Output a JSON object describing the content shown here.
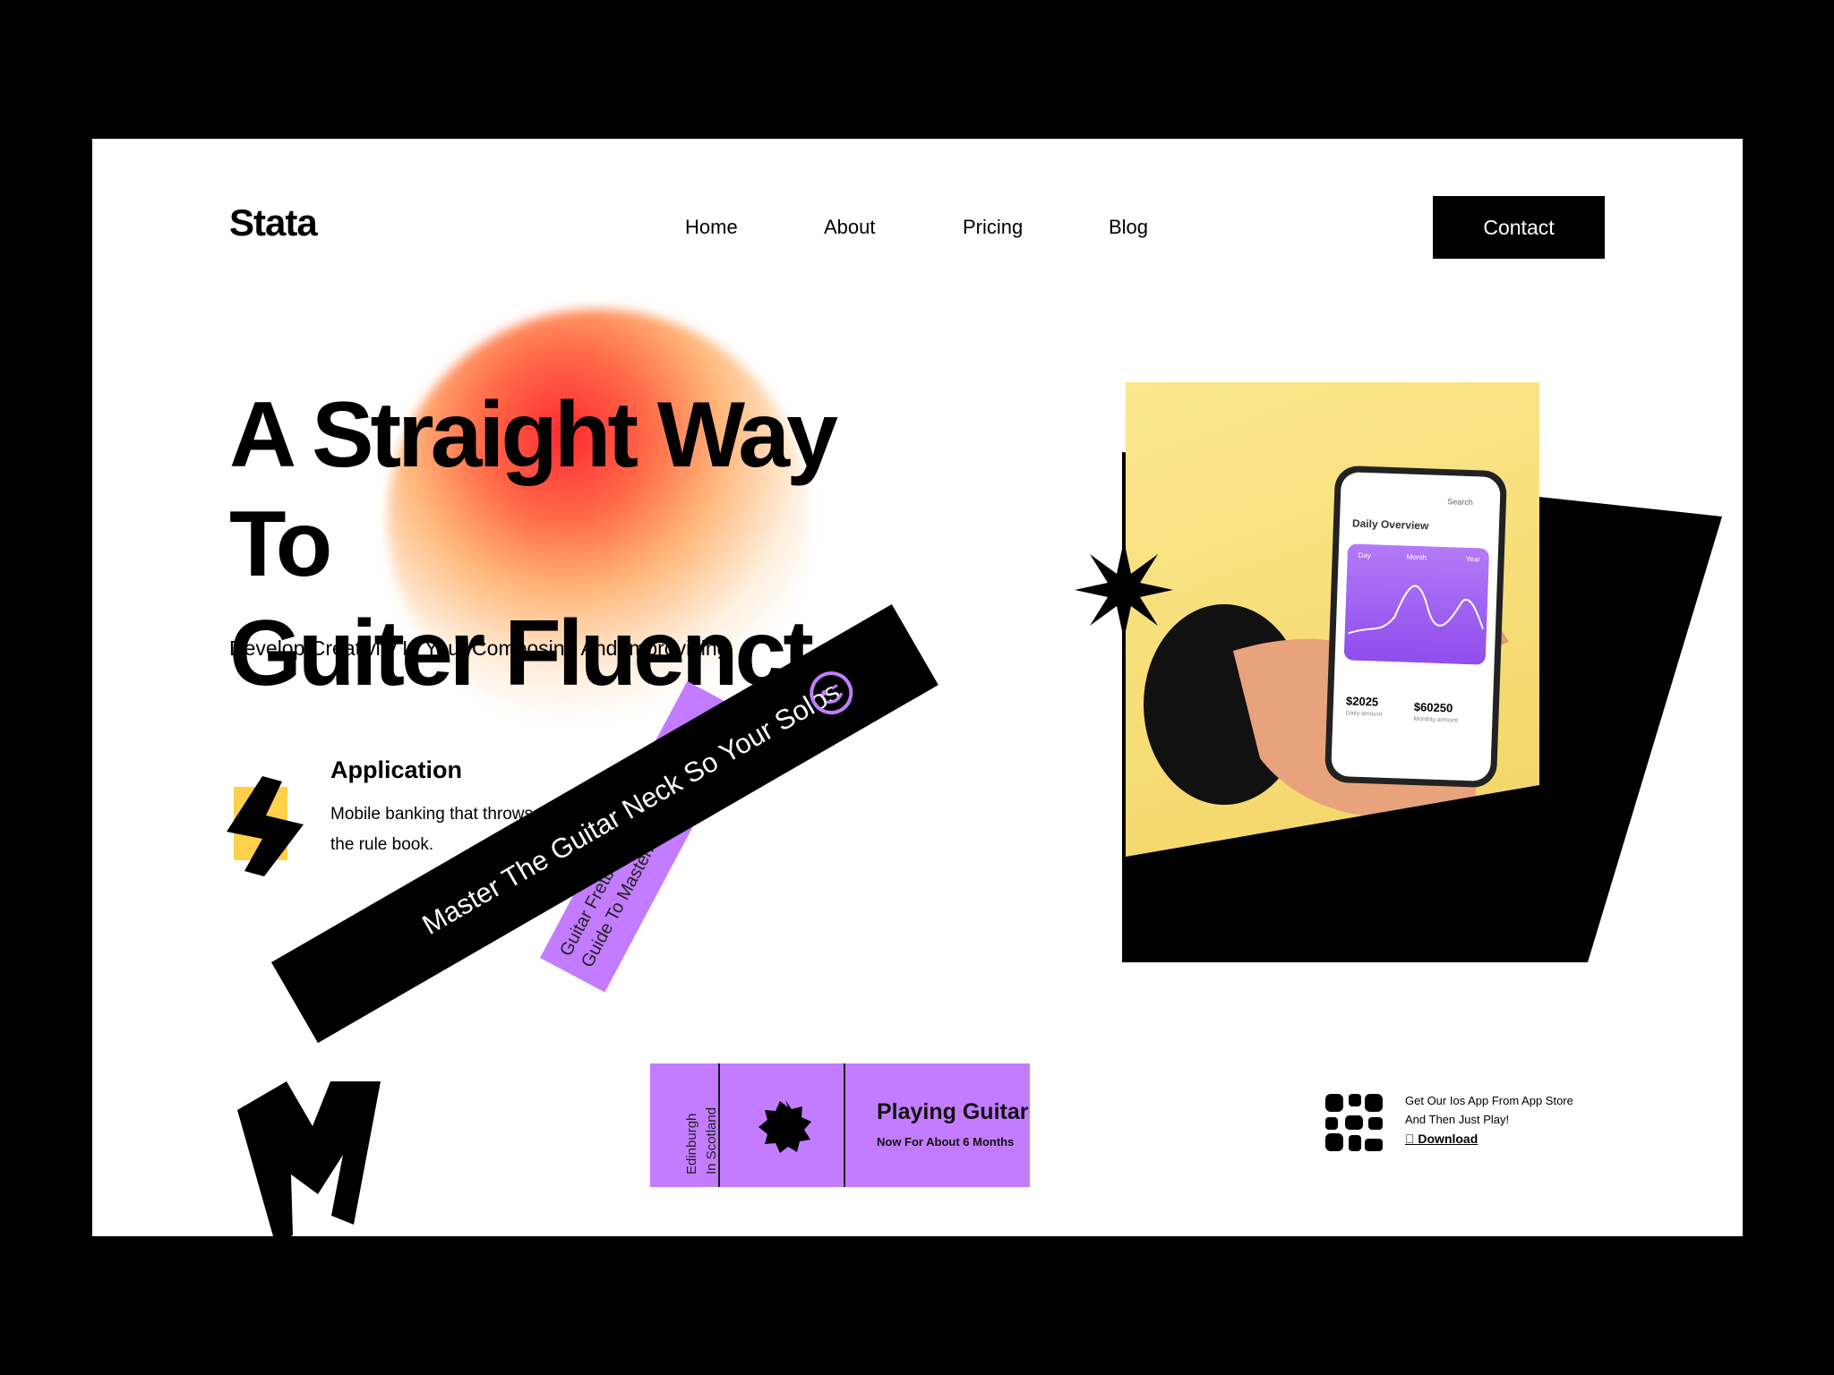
{
  "brand": {
    "logo": "Stata"
  },
  "nav": {
    "items": [
      "Home",
      "About",
      "Pricing",
      "Blog"
    ],
    "contact": "Contact"
  },
  "hero": {
    "title": "A Straight Way To\nGuiter Fluenct",
    "subtitle": "Develop Creativity In Your Composing And Improvising"
  },
  "feature": {
    "icon": "lightning-bolt-icon",
    "title": "Application",
    "description": "Mobile banking that throws out the rule book."
  },
  "ribbons": {
    "black": "Master The Guitar Neck So Your Solos",
    "purple": "Guitar Fretboard Fluency: A\nGuide To Mastering The Guitar."
  },
  "ticket": {
    "location": "Edinburgh\nIn Scotland",
    "title": "Playing Guitar",
    "subtitle": "Now For About 6 Months"
  },
  "download": {
    "text": "Get Our Ios App From App Store And Then Just Play!",
    "link": "Download"
  },
  "phone_screen": {
    "search": "Search",
    "title": "Daily Overview",
    "tabs": [
      "Day",
      "Month",
      "Year"
    ],
    "amount1": "$2025",
    "amount1_label": "Daily amount",
    "amount2": "$60250",
    "amount2_label": "Monthly amount"
  },
  "colors": {
    "purple": "#c37cff",
    "yellow": "#f6dc74",
    "accent_red": "#ff2a2a"
  }
}
